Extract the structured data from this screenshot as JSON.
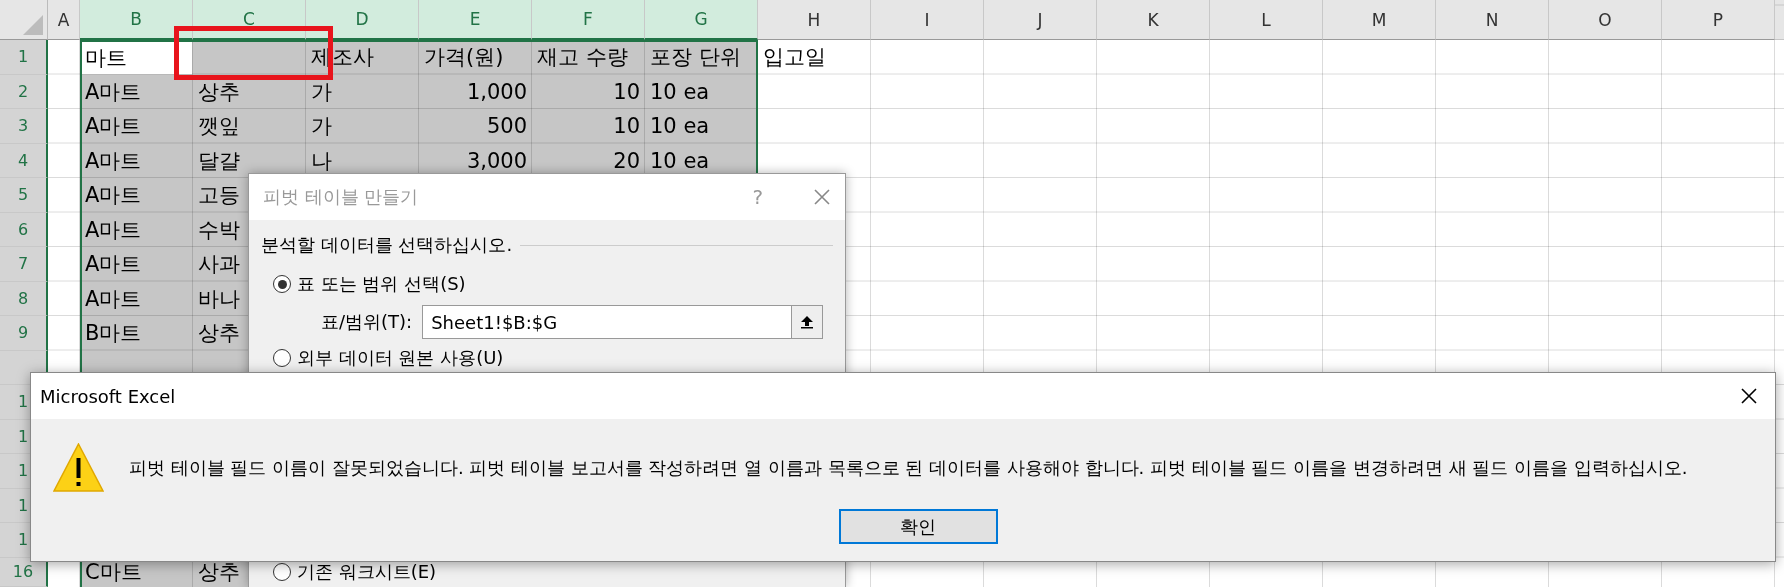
{
  "sheet": {
    "columns": [
      {
        "label": "A",
        "selected": false
      },
      {
        "label": "B",
        "selected": true
      },
      {
        "label": "C",
        "selected": true
      },
      {
        "label": "D",
        "selected": true
      },
      {
        "label": "E",
        "selected": true
      },
      {
        "label": "F",
        "selected": true
      },
      {
        "label": "G",
        "selected": true
      },
      {
        "label": "H",
        "selected": false
      },
      {
        "label": "I",
        "selected": false
      },
      {
        "label": "J",
        "selected": false
      },
      {
        "label": "K",
        "selected": false
      },
      {
        "label": "L",
        "selected": false
      },
      {
        "label": "M",
        "selected": false
      },
      {
        "label": "N",
        "selected": false
      },
      {
        "label": "O",
        "selected": false
      },
      {
        "label": "P",
        "selected": false
      }
    ],
    "rows": [
      {
        "label": "1",
        "selected": true,
        "cells": [
          null,
          {
            "text": "마트",
            "kind": "text",
            "active": true
          },
          null,
          {
            "text": "제조사",
            "kind": "text",
            "active": false
          },
          {
            "text": "가격(원)",
            "kind": "text",
            "active": false
          },
          {
            "text": "재고 수량",
            "kind": "text",
            "active": false
          },
          {
            "text": "포장 단위",
            "kind": "text",
            "active": false
          },
          {
            "text": "입고일",
            "kind": "text",
            "active": false
          }
        ]
      },
      {
        "label": "2",
        "selected": true,
        "cells": [
          null,
          {
            "text": "A마트",
            "kind": "text",
            "active": false
          },
          {
            "text": "상추",
            "kind": "text",
            "active": false
          },
          {
            "text": "가",
            "kind": "text",
            "active": false
          },
          {
            "text": "1,000",
            "kind": "number",
            "active": false
          },
          {
            "text": "10",
            "kind": "number",
            "active": false
          },
          {
            "text": "10 ea",
            "kind": "text",
            "active": false
          }
        ]
      },
      {
        "label": "3",
        "selected": true,
        "cells": [
          null,
          {
            "text": "A마트",
            "kind": "text",
            "active": false
          },
          {
            "text": "깻잎",
            "kind": "text",
            "active": false
          },
          {
            "text": "가",
            "kind": "text",
            "active": false
          },
          {
            "text": "500",
            "kind": "number",
            "active": false
          },
          {
            "text": "10",
            "kind": "number",
            "active": false
          },
          {
            "text": "10 ea",
            "kind": "text",
            "active": false
          }
        ]
      },
      {
        "label": "4",
        "selected": true,
        "cells": [
          null,
          {
            "text": "A마트",
            "kind": "text",
            "active": false
          },
          {
            "text": "달걀",
            "kind": "text",
            "active": false
          },
          {
            "text": "나",
            "kind": "text",
            "active": false
          },
          {
            "text": "3,000",
            "kind": "number",
            "active": false
          },
          {
            "text": "20",
            "kind": "number",
            "active": false
          },
          {
            "text": "10 ea",
            "kind": "text",
            "active": false
          }
        ]
      },
      {
        "label": "5",
        "selected": true,
        "cells": [
          null,
          {
            "text": "A마트",
            "kind": "text",
            "active": false
          },
          {
            "text": "고등",
            "kind": "text",
            "active": false
          }
        ]
      },
      {
        "label": "6",
        "selected": true,
        "cells": [
          null,
          {
            "text": "A마트",
            "kind": "text",
            "active": false
          },
          {
            "text": "수박",
            "kind": "text",
            "active": false
          }
        ]
      },
      {
        "label": "7",
        "selected": true,
        "cells": [
          null,
          {
            "text": "A마트",
            "kind": "text",
            "active": false
          },
          {
            "text": "사과",
            "kind": "text",
            "active": false
          }
        ]
      },
      {
        "label": "8",
        "selected": true,
        "cells": [
          null,
          {
            "text": "A마트",
            "kind": "text",
            "active": false
          },
          {
            "text": "바나",
            "kind": "text",
            "active": false
          }
        ]
      },
      {
        "label": "9",
        "selected": true,
        "cells": [
          null,
          {
            "text": "B마트",
            "kind": "text",
            "active": false
          },
          {
            "text": "상추",
            "kind": "text",
            "active": false
          }
        ]
      },
      {
        "selected": true
      },
      {
        "label": "1",
        "selected": true
      },
      {
        "label": "1",
        "selected": true
      },
      {
        "label": "1",
        "selected": true
      },
      {
        "label": "1",
        "selected": true
      },
      {
        "label": "1",
        "selected": true
      },
      {
        "label": "16",
        "selected": true,
        "cells": [
          null,
          {
            "text": "C마트",
            "kind": "text",
            "active": false
          },
          {
            "text": "상추",
            "kind": "text",
            "active": false
          }
        ]
      }
    ]
  },
  "pivot_dialog": {
    "title": "피벗 테이블 만들기",
    "active": false,
    "help": "?",
    "section": "분석할 데이터를 선택하십시오.",
    "source_options": [
      {
        "label": "표 또는 범위 선택(S)",
        "selected": true
      },
      {
        "label": "외부 데이터 원본 사용(U)",
        "selected": false
      }
    ],
    "range_label": "표/범위(T):",
    "range_value": "Sheet1!$B:$G",
    "location_options": [
      {
        "label": "기존 워크시트(E)",
        "selected": false
      }
    ]
  },
  "message_box": {
    "title": "Microsoft Excel",
    "message": "피벗 테이블 필드 이름이 잘못되었습니다. 피벗 테이블 보고서를 작성하려면 열 이름과 목록으로 된 데이터를 사용해야 합니다. 피벗 테이블 필드 이름을 변경하려면 새 필드 이름을 입력하십시오.",
    "buttons": [
      {
        "label": "확인",
        "focused": true
      }
    ]
  }
}
